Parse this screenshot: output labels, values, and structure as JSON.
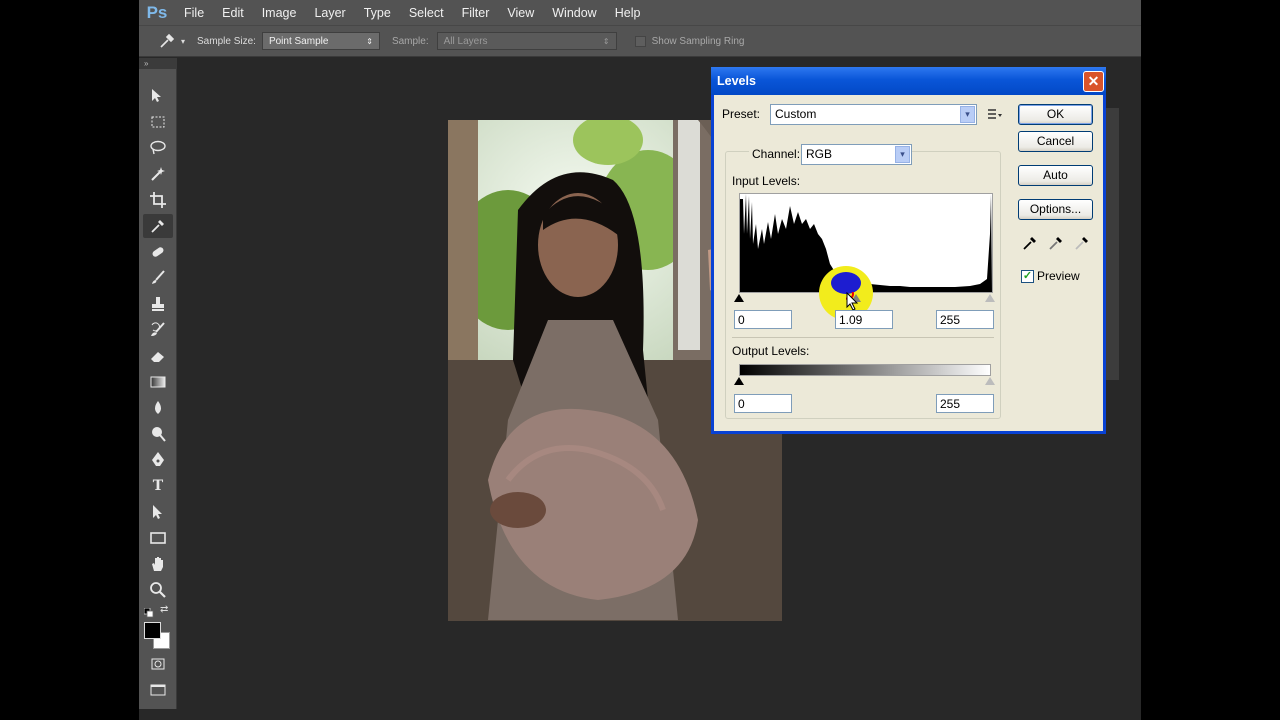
{
  "app": {
    "logo": "Ps"
  },
  "menu": [
    "File",
    "Edit",
    "Image",
    "Layer",
    "Type",
    "Select",
    "Filter",
    "View",
    "Window",
    "Help"
  ],
  "options_bar": {
    "sample_size_label": "Sample Size:",
    "sample_size_value": "Point Sample",
    "sample_label": "Sample:",
    "sample_value": "All Layers",
    "sampling_ring_label": "Show Sampling Ring",
    "sampling_ring_checked": false
  },
  "tools": {
    "header": "»",
    "items": [
      "move-tool",
      "marquee-tool",
      "lasso-tool",
      "quick-select-tool",
      "crop-tool",
      "eyedropper-tool",
      "spot-healing-tool",
      "brush-tool",
      "clone-stamp-tool",
      "history-brush-tool",
      "eraser-tool",
      "gradient-tool",
      "blur-tool",
      "dodge-tool",
      "pen-tool",
      "type-tool",
      "path-select-tool",
      "rectangle-tool",
      "hand-tool",
      "zoom-tool"
    ],
    "active": "eyedropper-tool",
    "foreground_color": "#000000",
    "background_color": "#ffffff",
    "type_glyph": "T"
  },
  "levels": {
    "title": "Levels",
    "close_glyph": "✕",
    "preset_label": "Preset:",
    "preset_value": "Custom",
    "channel_label": "Channel:",
    "channel_value": "RGB",
    "input_levels_label": "Input Levels:",
    "input_black": "0",
    "input_gamma": "1.09",
    "input_white": "255",
    "output_levels_label": "Output Levels:",
    "output_black": "0",
    "output_white": "255",
    "buttons": {
      "ok": "OK",
      "cancel": "Cancel",
      "auto": "Auto",
      "options": "Options..."
    },
    "preview_label": "Preview",
    "preview_checked": true,
    "check_glyph": "✓",
    "arrow_glyph": "▾"
  }
}
